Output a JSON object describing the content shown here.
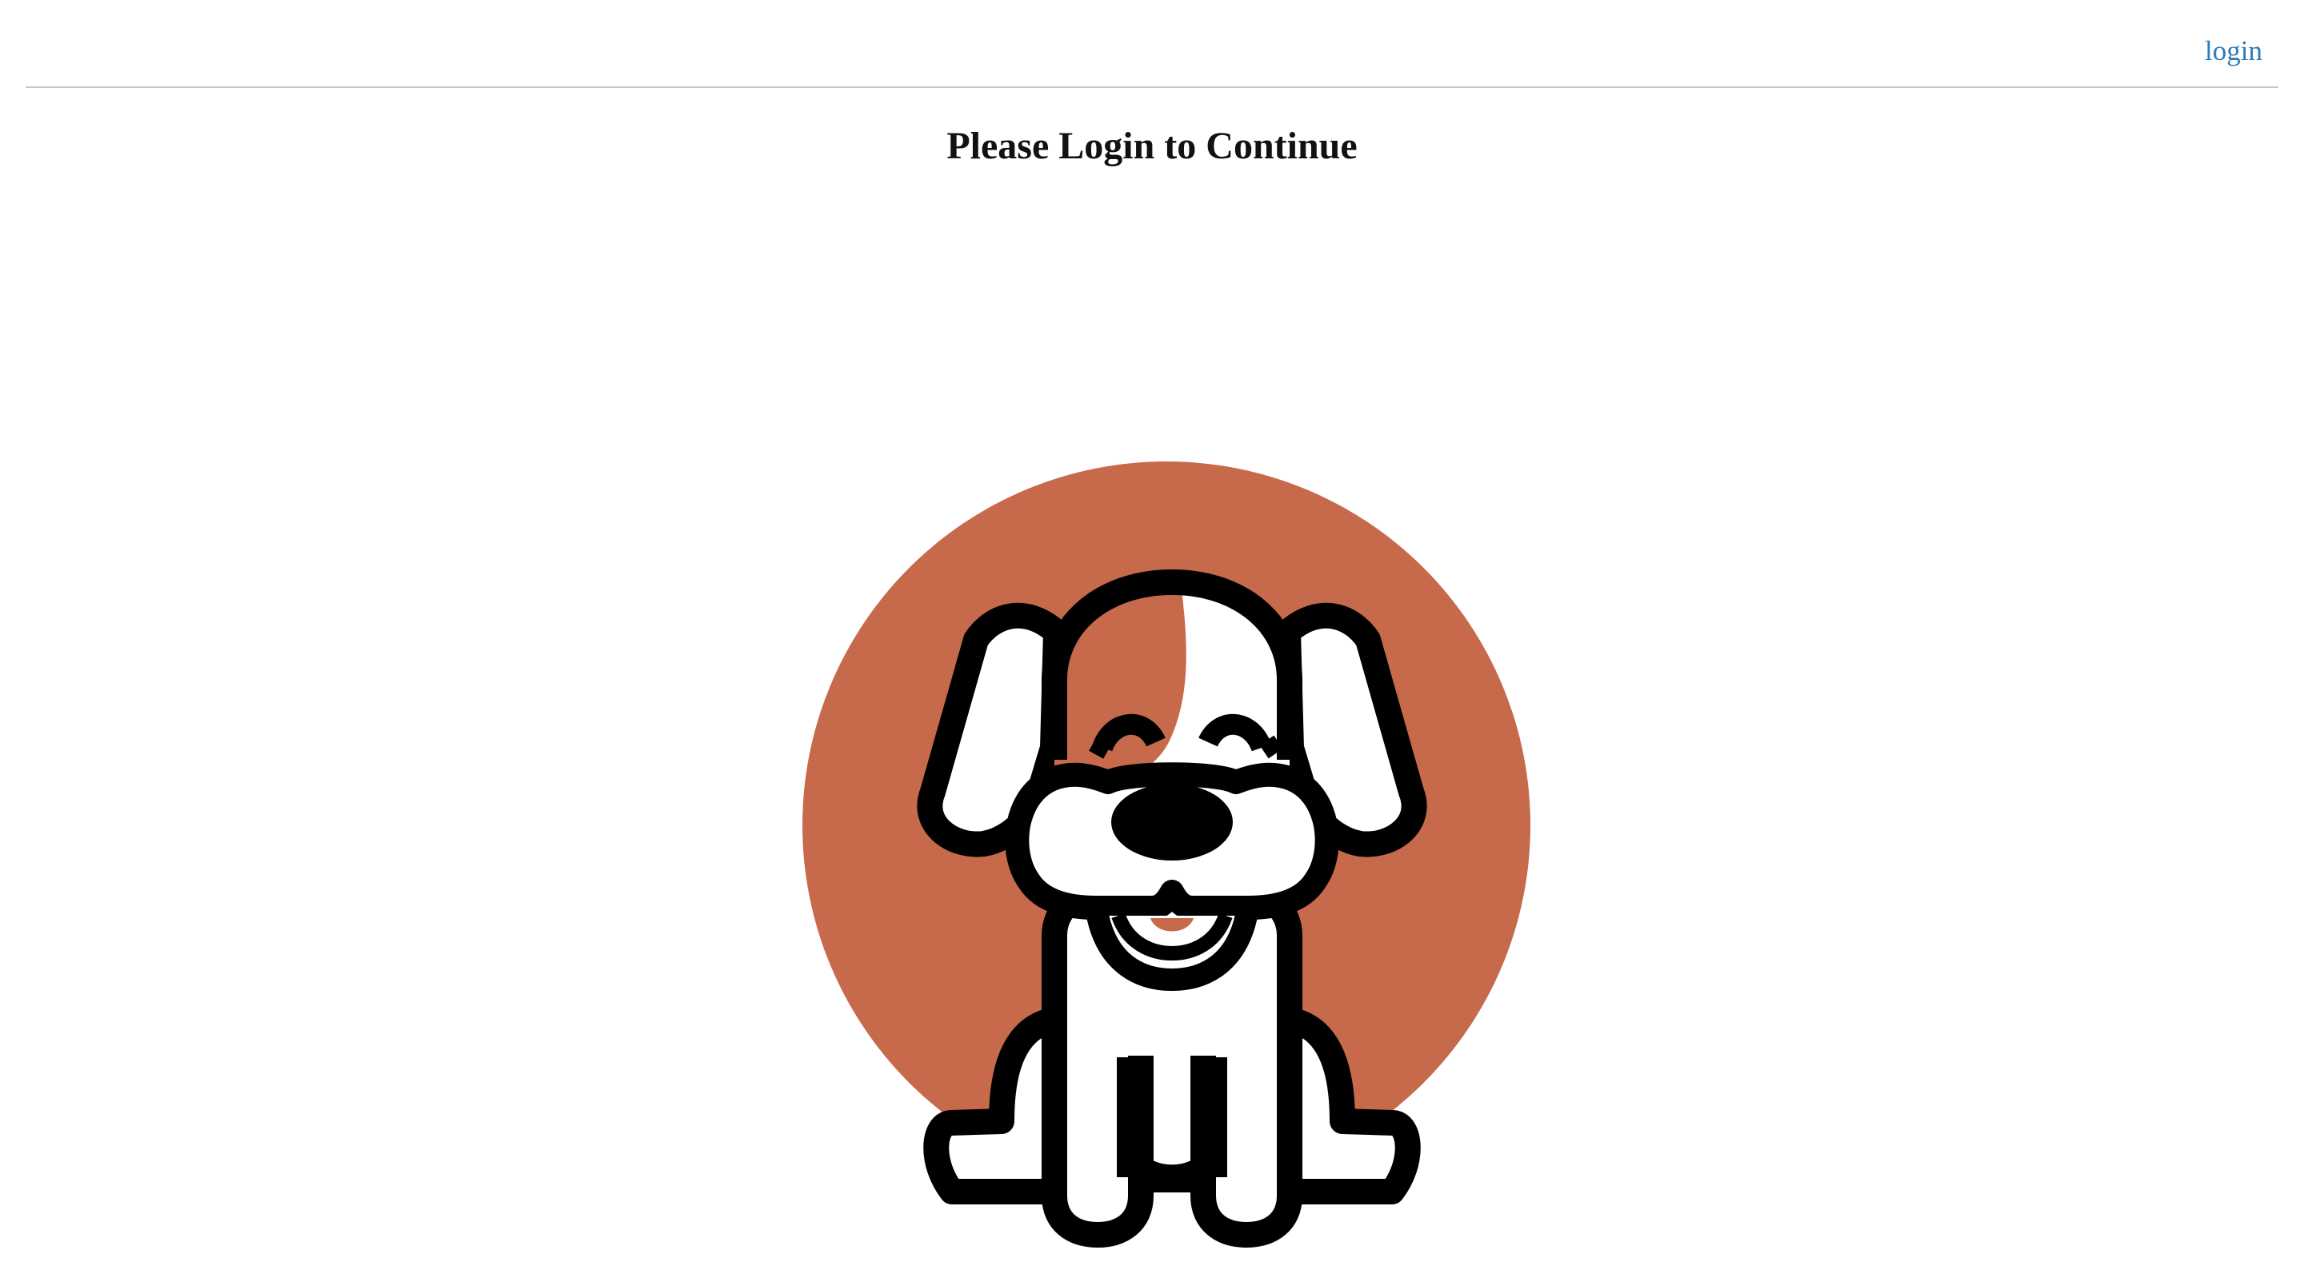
{
  "header": {
    "login_label": "login"
  },
  "main": {
    "title": "Please Login to Continue"
  },
  "mascot": {
    "icon": "dog-mascot-icon",
    "background_color": "#C76A4C",
    "outline_color": "#000000",
    "fill_color": "#FFFFFF"
  },
  "colors": {
    "link": "#2F7AB9",
    "divider": "#C6C6C6",
    "title": "#111111"
  }
}
